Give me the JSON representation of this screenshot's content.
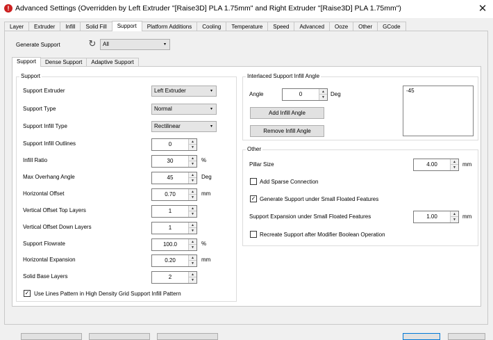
{
  "window": {
    "title": "Advanced Settings (Overridden by Left Extruder \"[Raise3D] PLA 1.75mm\" and Right Extruder \"[Raise3D] PLA 1.75mm\")",
    "close_icon": "✕"
  },
  "tabs": [
    "Layer",
    "Extruder",
    "Infill",
    "Solid Fill",
    "Support",
    "Platform Additions",
    "Cooling",
    "Temperature",
    "Speed",
    "Advanced",
    "Ooze",
    "Other",
    "GCode"
  ],
  "active_tab": "Support",
  "generate_support": {
    "label": "Generate Support",
    "value": "All"
  },
  "subtabs": [
    "Support",
    "Dense Support",
    "Adaptive Support"
  ],
  "support_group": {
    "title": "Support",
    "extruder": {
      "label": "Support Extruder",
      "value": "Left Extruder"
    },
    "type": {
      "label": "Support Type",
      "value": "Normal"
    },
    "infill_type": {
      "label": "Support Infill Type",
      "value": "Rectilinear"
    },
    "infill_outlines": {
      "label": "Support Infill Outlines",
      "value": "0"
    },
    "infill_ratio": {
      "label": "Infill Ratio",
      "value": "30",
      "unit": "%"
    },
    "max_overhang": {
      "label": "Max Overhang Angle",
      "value": "45",
      "unit": "Deg"
    },
    "horizontal_offset": {
      "label": "Horizontal Offset",
      "value": "0.70",
      "unit": "mm"
    },
    "vertical_offset_top": {
      "label": "Vertical Offset Top Layers",
      "value": "1"
    },
    "vertical_offset_down": {
      "label": "Vertical Offset Down Layers",
      "value": "1"
    },
    "flowrate": {
      "label": "Support Flowrate",
      "value": "100.0",
      "unit": "%"
    },
    "horizontal_expansion": {
      "label": "Horizontal Expansion",
      "value": "0.20",
      "unit": "mm"
    },
    "solid_base_layers": {
      "label": "Solid Base Layers",
      "value": "2"
    },
    "use_lines_pattern": {
      "label": "Use Lines Pattern in High Density Grid Support Infill Pattern",
      "checked": true
    }
  },
  "interlaced_group": {
    "title": "Interlaced Support Infill Angle",
    "angle": {
      "label": "Angle",
      "value": "0",
      "unit": "Deg"
    },
    "add_button": "Add Infill Angle",
    "remove_button": "Remove Infill Angle",
    "angle_list": [
      "-45"
    ]
  },
  "other_group": {
    "title": "Other",
    "pillar_size": {
      "label": "Pillar Size",
      "value": "4.00",
      "unit": "mm"
    },
    "add_sparse": {
      "label": "Add Sparse Connection",
      "checked": false
    },
    "generate_small": {
      "label": "Generate Support under Small Floated Features",
      "checked": true
    },
    "support_expansion": {
      "label": "Support Expansion under Small Floated Features",
      "value": "1.00",
      "unit": "mm"
    },
    "recreate": {
      "label": "Recreate Support after Modifier Boolean Operation",
      "checked": false
    }
  },
  "glyphs": {
    "check": "✓",
    "dropdown": "▾",
    "spin_up": "▲",
    "spin_down": "▼",
    "refresh": "↻"
  }
}
